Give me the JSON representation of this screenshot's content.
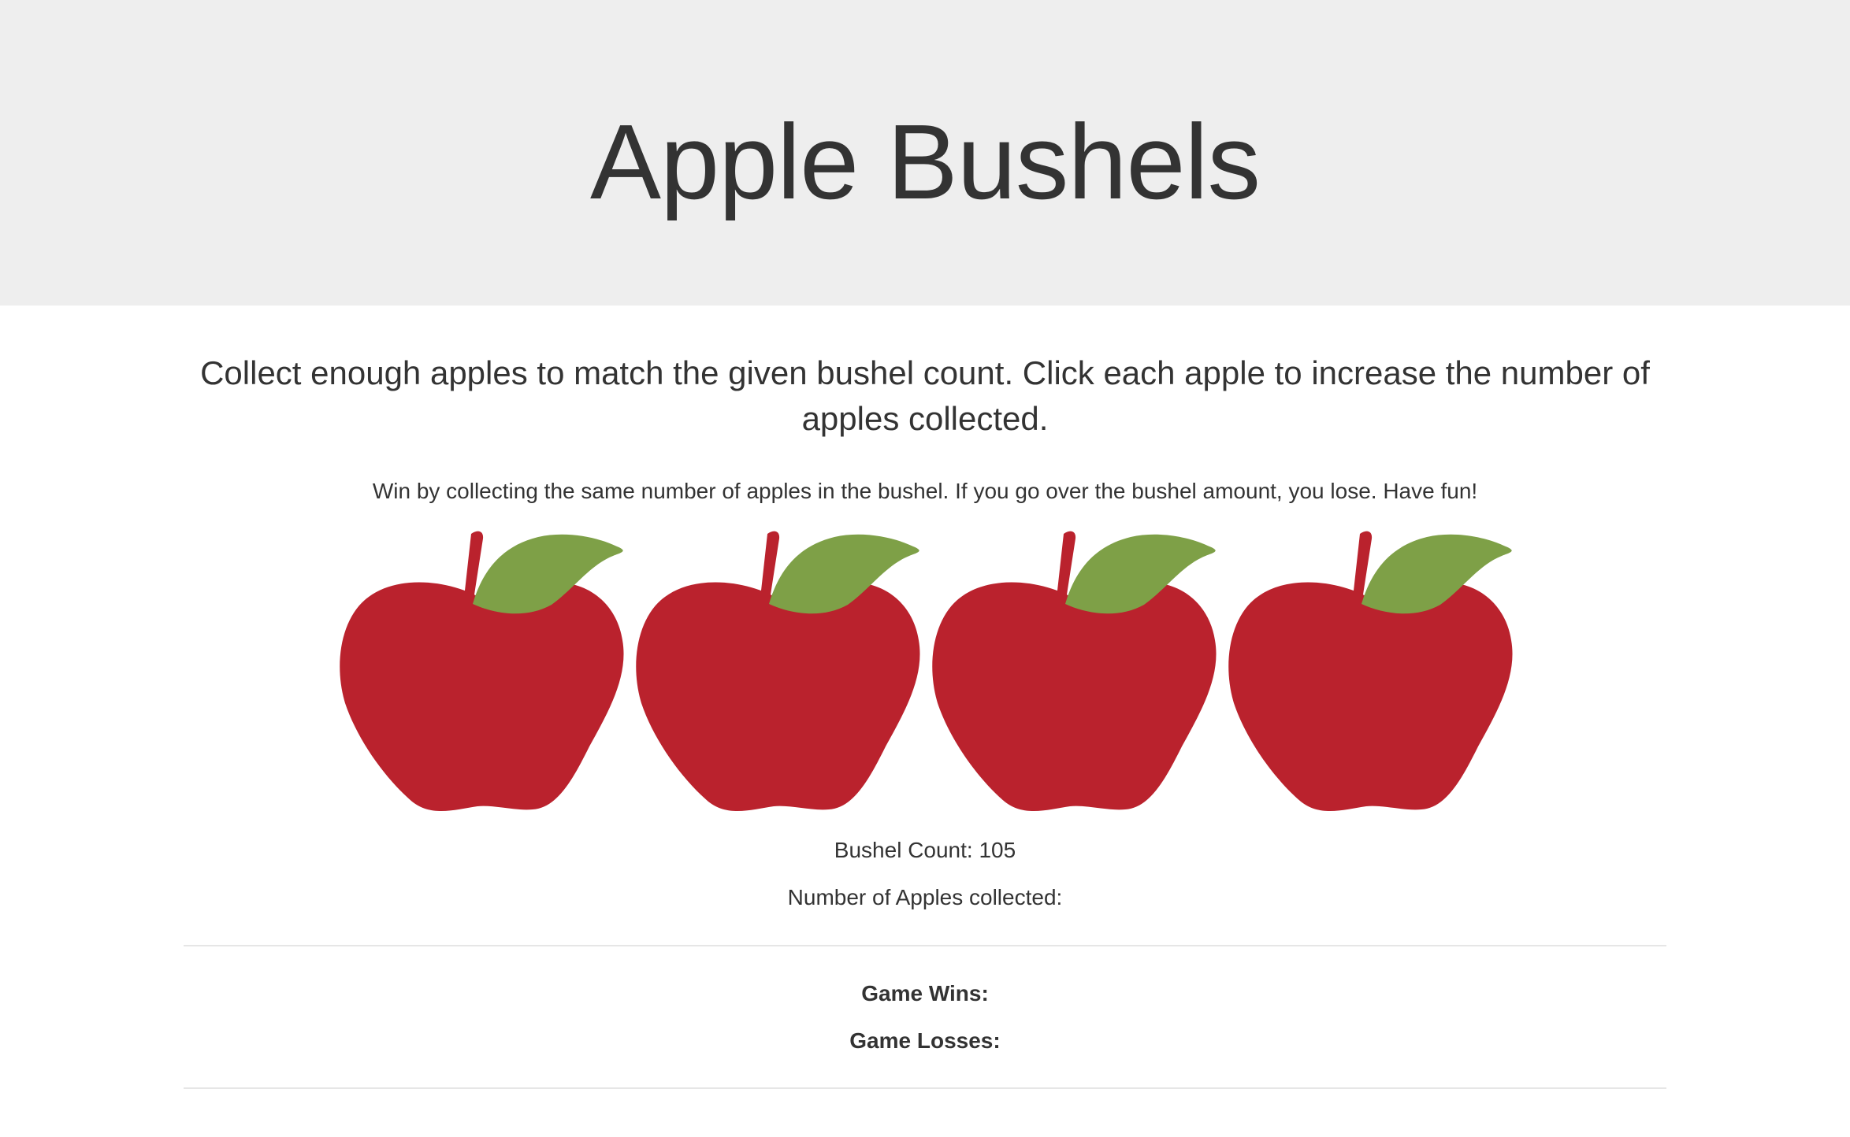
{
  "header": {
    "title": "Apple Bushels"
  },
  "instructions": {
    "lead": "Collect enough apples to match the given bushel count. Click each apple to increase the number of apples collected.",
    "rules": "Win by collecting the same number of apples in the bushel. If you go over the bushel amount, you lose. Have fun!"
  },
  "apples": [
    {
      "icon": "apple-icon"
    },
    {
      "icon": "apple-icon"
    },
    {
      "icon": "apple-icon"
    },
    {
      "icon": "apple-icon"
    }
  ],
  "stats": {
    "bushel_count_label": "Bushel Count: 105",
    "apples_collected_label": "Number of Apples collected:"
  },
  "scoreboard": {
    "wins_label": "Game Wins:",
    "losses_label": "Game Losses:"
  },
  "colors": {
    "apple_red": "#ba222d",
    "leaf_green": "#7ea047",
    "header_bg": "#eeeeee",
    "text": "#333333"
  }
}
